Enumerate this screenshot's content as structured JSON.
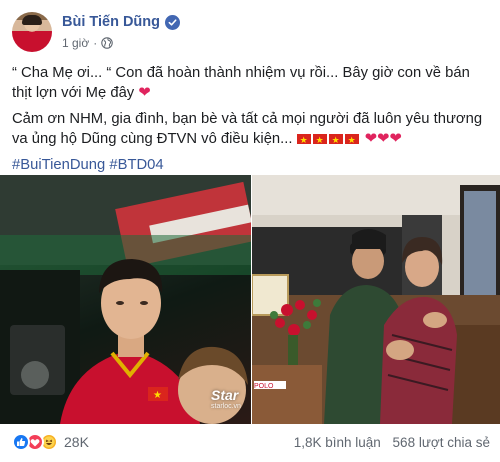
{
  "post": {
    "author": "Bùi Tiến Dũng",
    "time": "1 giờ",
    "separator": "·",
    "text_line1": "“ Cha Mẹ ơi... “ Con đã hoàn thành nhiệm vụ rồi... Bây giờ con về bán thịt lợn với Mẹ đây",
    "text_line2": "Cảm ơn NHM, gia đình, bạn bè và tất cả mọi người đã luôn yêu thương va ủng hộ Dũng cùng ĐTVN vô điều kiện...",
    "hashtags": [
      "#BuiTienDung",
      "#BTD04"
    ],
    "emoji_heart": "❤"
  },
  "photos": {
    "left_watermark": "Star",
    "left_watermark_sub": "starloc.vn",
    "right_banner_text": "POLO"
  },
  "footer": {
    "reaction_count": "28K",
    "comments": "1,8K bình luận",
    "shares": "568 lượt chia sẻ"
  },
  "colors": {
    "link_blue": "#385898",
    "verified_blue": "#4267b2",
    "heart_red": "#e0245e"
  }
}
